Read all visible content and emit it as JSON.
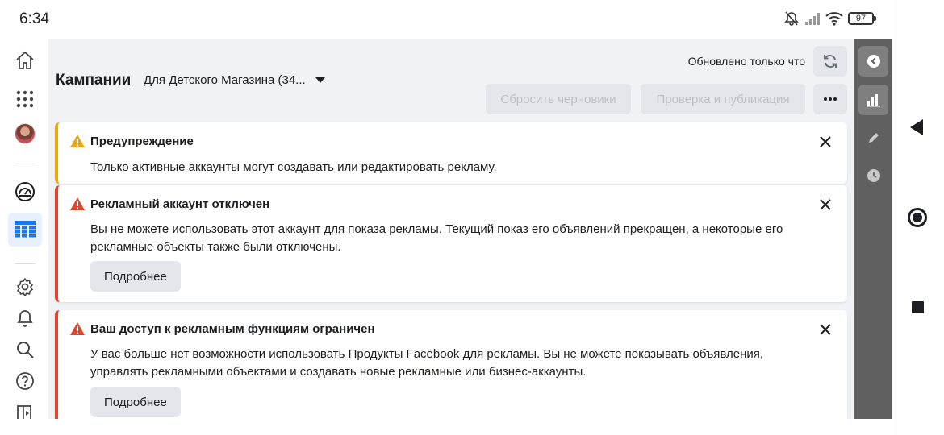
{
  "status_bar": {
    "time": "6:34",
    "battery": "97",
    "icons": [
      "mute-icon",
      "signal-icon",
      "wifi-icon",
      "battery-icon"
    ]
  },
  "left_nav": {
    "items": [
      "home-icon",
      "apps-grid-icon",
      "avatar",
      "dashboard-gauge-icon",
      "ads-manager-table-icon",
      "settings-icon",
      "notifications-icon",
      "search-icon",
      "help-icon",
      "reports-icon"
    ],
    "active": "ads-manager-table-icon"
  },
  "header": {
    "title": "Кампании",
    "account": "Для Детского Магазина (34...",
    "updated": "Обновлено только что",
    "reset_label": "Сбросить черновики",
    "publish_label": "Проверка и публикация"
  },
  "alerts": [
    {
      "type": "warning",
      "title": "Предупреждение",
      "body": "Только активные аккаунты могут создавать или редактировать рекламу."
    },
    {
      "type": "error",
      "title": "Рекламный аккаунт отключен",
      "body": "Вы не можете использовать этот аккаунт для показа рекламы. Текущий показ его объявлений прекращен, а некоторые его рекламные объекты также были отключены.",
      "button": "Подробнее"
    },
    {
      "type": "error",
      "title": "Ваш доступ к рекламным функциям ограничен",
      "body": "У вас больше нет возможности использовать Продукты Facebook для рекламы. Вы не можете показывать объявления, управлять рекламными объектами и создавать новые рекламные или бизнес-аккаунты.",
      "button": "Подробнее"
    }
  ],
  "right_rail": {
    "items": [
      "collapse-icon",
      "chart-icon",
      "edit-icon",
      "history-icon"
    ],
    "active": "chart-icon"
  },
  "colors": {
    "warning": "#e9a618",
    "error": "#e0452d",
    "active_nav": "#1877f2",
    "rail_bg": "#606060",
    "page_bg": "#f0f2f5"
  }
}
